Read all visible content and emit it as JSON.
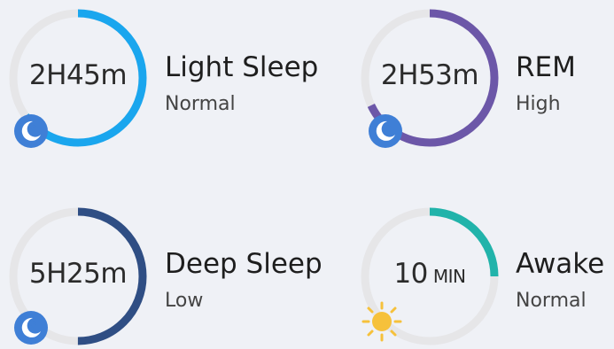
{
  "stages": [
    {
      "id": "light",
      "value": "2H45m",
      "title": "Light Sleep",
      "status": "Normal",
      "progress": 0.65,
      "color": "#1aa6ee",
      "icon": "moon-zz-icon"
    },
    {
      "id": "rem",
      "value": "2H53m",
      "title": "REM",
      "status": "High",
      "progress": 0.68,
      "color": "#6c57a8",
      "icon": "moon-zz-icon"
    },
    {
      "id": "deep",
      "value": "5H25m",
      "title": "Deep Sleep",
      "status": "Low",
      "progress": 0.5,
      "color": "#2f4e84",
      "icon": "moon-zz-icon"
    },
    {
      "id": "awake",
      "value_number": "10",
      "value_unit": "MIN",
      "title": "Awake",
      "status": "Normal",
      "progress": 0.25,
      "color": "#21b3aa",
      "icon": "sun-icon"
    }
  ],
  "colors": {
    "track": "#e6e6e8",
    "badge_blue": "#3f7fd6",
    "sun": "#f6c13b",
    "background": "#eff1f6"
  }
}
